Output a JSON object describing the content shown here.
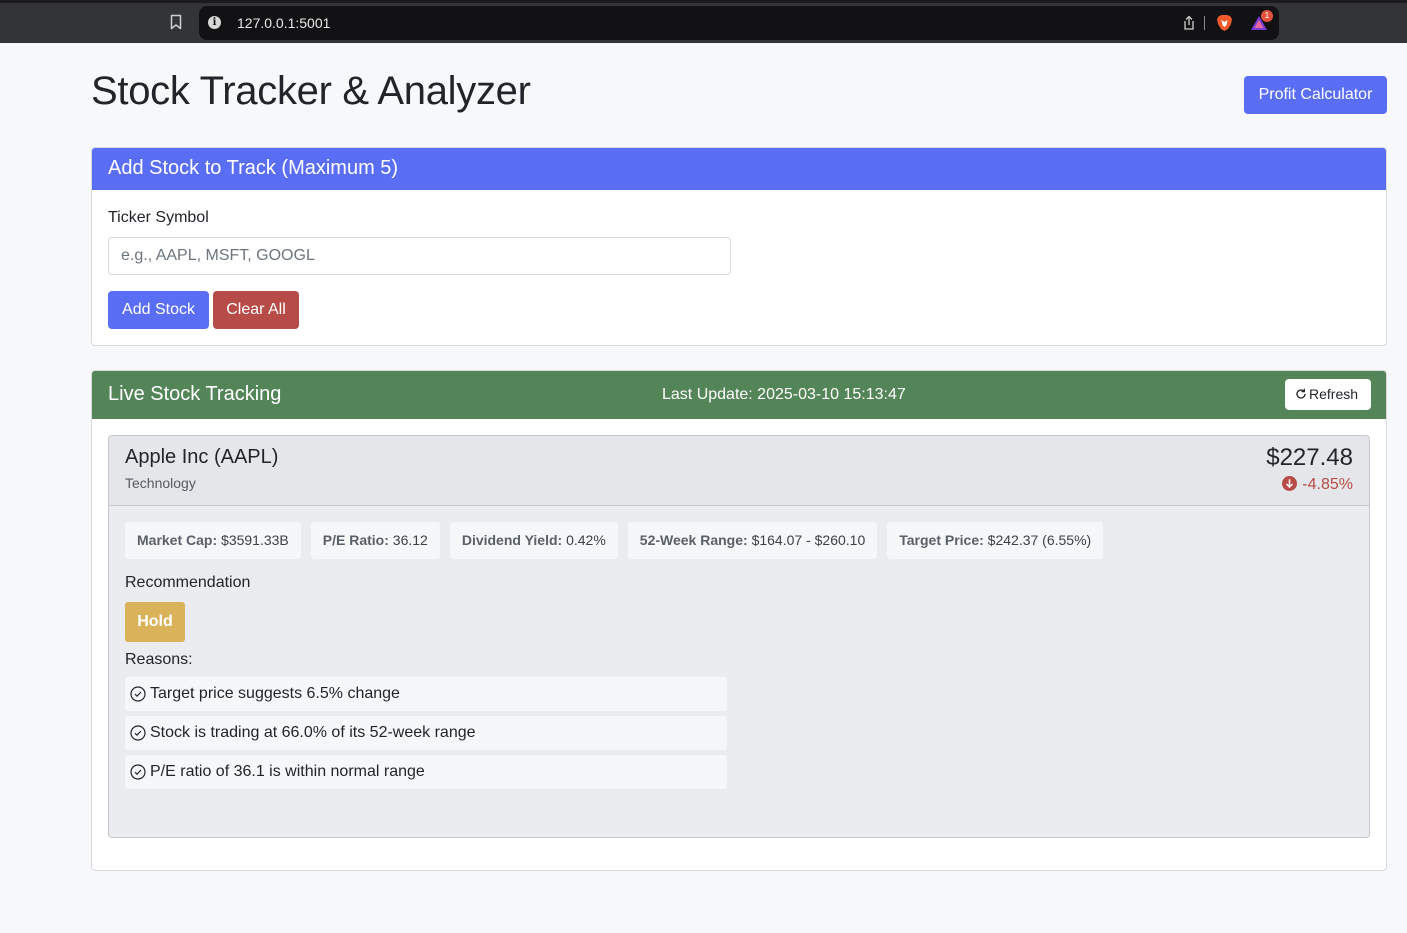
{
  "browser": {
    "url": "127.0.0.1:5001",
    "rewards_count": "1"
  },
  "header": {
    "title": "Stock Tracker & Analyzer",
    "profit_button": "Profit Calculator"
  },
  "add_card": {
    "title": "Add Stock to Track (Maximum 5)",
    "ticker_label": "Ticker Symbol",
    "ticker_placeholder": "e.g., AAPL, MSFT, GOOGL",
    "ticker_value": "",
    "add_button": "Add Stock",
    "clear_button": "Clear All"
  },
  "live_card": {
    "title": "Live Stock Tracking",
    "last_update": "Last Update: 2025-03-10 15:13:47",
    "refresh_button": "Refresh"
  },
  "stock": {
    "name": "Apple Inc (AAPL)",
    "sector": "Technology",
    "price": "$227.48",
    "change": "-4.85%",
    "metrics": [
      {
        "label": "Market Cap:",
        "value": "$3591.33B"
      },
      {
        "label": "P/E Ratio:",
        "value": "36.12"
      },
      {
        "label": "Dividend Yield:",
        "value": "0.42%"
      },
      {
        "label": "52-Week Range:",
        "value": "$164.07 - $260.10"
      },
      {
        "label": "Target Price:",
        "value": "$242.37 (6.55%)"
      }
    ],
    "recommendation_label": "Recommendation",
    "recommendation": "Hold",
    "reasons_label": "Reasons:",
    "reasons": [
      "Target price suggests 6.5% change",
      "Stock is trading at 66.0% of its 52-week range",
      "P/E ratio of 36.1 is within normal range"
    ]
  },
  "colors": {
    "primary": "#5a6ef5",
    "danger": "#b74b47",
    "success": "#548559",
    "warning": "#d9b25a"
  },
  "icons": [
    "bookmark-icon",
    "info-icon",
    "share-icon",
    "brave-shield-icon",
    "brave-rewards-icon",
    "refresh-icon",
    "arrow-down-circle-icon",
    "check-circle-icon"
  ]
}
